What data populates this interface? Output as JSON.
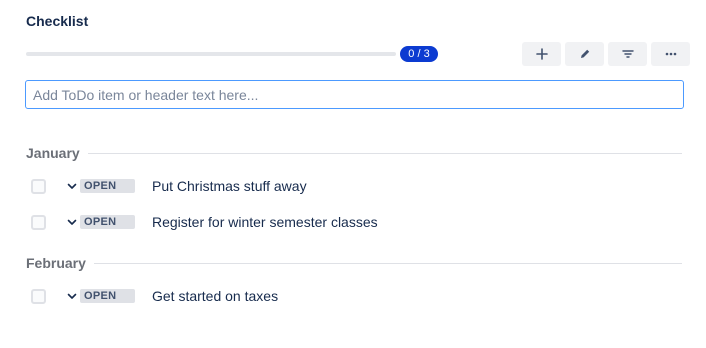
{
  "checklist": {
    "title": "Checklist",
    "progress": {
      "label": "0 / 3",
      "completed": 0,
      "total": 3
    },
    "toolbar": {
      "add_icon": "plus-icon",
      "edit_icon": "pencil-icon",
      "filter_icon": "filter-icon",
      "more_icon": "more-horizontal-icon"
    },
    "input": {
      "placeholder": "Add ToDo item or header text here...",
      "value": ""
    },
    "groups": [
      {
        "header": "January",
        "items": [
          {
            "status": "OPEN",
            "text": "Put Christmas stuff away"
          },
          {
            "status": "OPEN",
            "text": "Register for winter semester classes"
          }
        ]
      },
      {
        "header": "February",
        "items": [
          {
            "status": "OPEN",
            "text": "Get started on taxes"
          }
        ]
      }
    ],
    "colors": {
      "accent": "#0c3bd1",
      "focus_border": "#4c9aff",
      "status_bg": "#dfe1e6"
    }
  }
}
